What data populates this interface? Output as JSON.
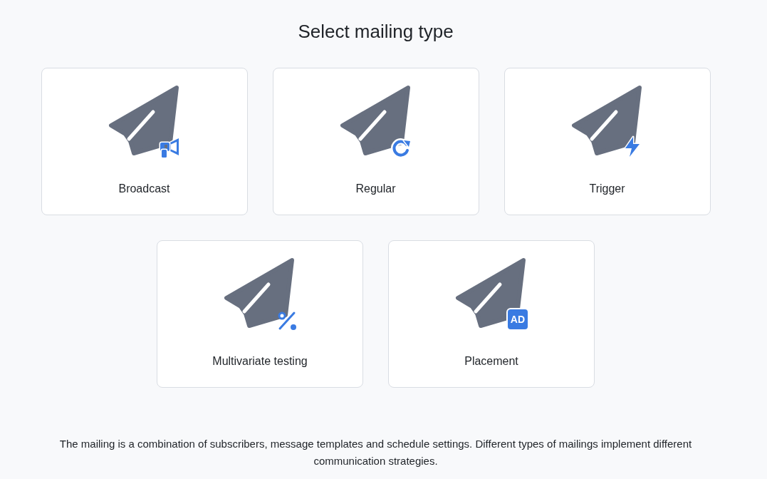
{
  "title": "Select mailing type",
  "mailing_types": [
    {
      "label": "Broadcast",
      "kind": "megaphone"
    },
    {
      "label": "Regular",
      "kind": "refresh"
    },
    {
      "label": "Trigger",
      "kind": "lightning"
    },
    {
      "label": "Multivariate testing",
      "kind": "percent"
    },
    {
      "label": "Placement",
      "kind": "ad",
      "badge_text": "AD"
    }
  ],
  "description": "The mailing is a combination of subscribers, message templates and schedule settings. Different types of mailings implement different communication strategies."
}
